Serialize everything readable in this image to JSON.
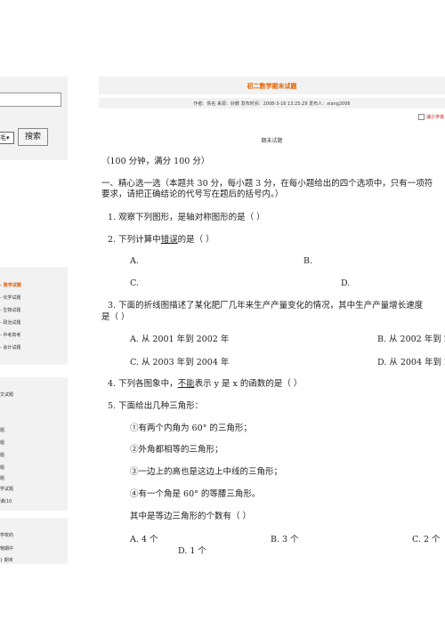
{
  "sidebar": {
    "search_button": "搜索",
    "select_value": "毛",
    "categories": [
      "- 数学试题",
      "- 化学试题",
      "- 生物试题",
      "- 政治试题",
      "- 中考高考",
      "- 会计试题"
    ],
    "list_a": [
      "文试题",
      "",
      "题",
      "题",
      "题",
      "题",
      "题",
      "学试题",
      "课(10"
    ],
    "list_b": [
      "学校的",
      "物期中",
      "} 期末"
    ]
  },
  "document": {
    "title": "初二数学期末试题",
    "meta": "作者：佚名  来源：好教  发布时间：2008-3-16 13:25:29  发布人：xiang2006",
    "font_control": "减小字体",
    "subtitle": "期末试题",
    "lines": {
      "time": "（100 分钟，满分 100 分）",
      "section1_a": "一、精心选一选（本题共 30 分，每小题 3 分，在每小题给出的四个选项中，只有一项符",
      "section1_b": "要求，请把正确结论的代号写在题后的括号内。）",
      "q1": "1.  观察下列图形，是轴对称图形的是（     ）",
      "q2_pre": "2.  下列计算中",
      "q2_mark": "错误",
      "q2_post": "的是（     ）",
      "q2_a": "A.",
      "q2_b": "B.",
      "q2_c": "C.",
      "q2_d": "D.",
      "q3_a": "3.  下面的折线图描述了某化肥厂几年来生产产量变化的情况，其中生产产量增长速度",
      "q3_b": "是（     ）",
      "q3_opt_a": "A.  从 2001 年到 2002 年",
      "q3_opt_b": "B.  从 2002 年到 2",
      "q3_opt_c": "C.  从 2003 年到 2004 年",
      "q3_opt_d": "D.  从 2004 年到 2",
      "q4_pre": "4.  下列各图象中，",
      "q4_mark": "不能",
      "q4_post": "表示 y 是 x 的函数的是（     ）",
      "q5": "5.  下面给出几种三角形：",
      "q5_1": "①有两个内角为 60° 的三角形；",
      "q5_2": "②外角都相等的三角形；",
      "q5_3": "③一边上的高也是这边上中线的三角形；",
      "q5_4": "④有一个角是 60° 的等腰三角形。",
      "q5_ask": "其中是等边三角形的个数有（     ）",
      "q5_a": "A.  4 个",
      "q5_b": "B.  3 个",
      "q5_c": "C.  2 个",
      "q5_d": "D.  1 个"
    }
  }
}
